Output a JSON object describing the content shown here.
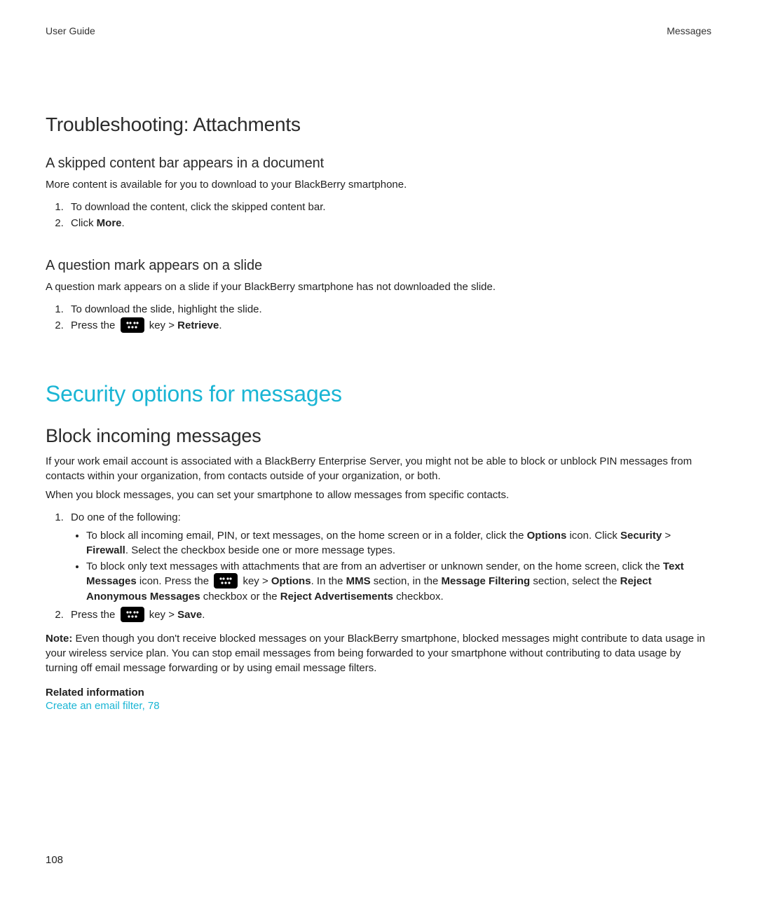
{
  "header": {
    "left": "User Guide",
    "right": "Messages"
  },
  "sections": {
    "troubleshooting": {
      "title": "Troubleshooting: Attachments",
      "skipped": {
        "heading": "A skipped content bar appears in a document",
        "intro": "More content is available for you to download to your BlackBerry smartphone.",
        "step1": "To download the content, click the skipped content bar.",
        "step2_prefix": "Click ",
        "step2_bold": "More",
        "step2_suffix": "."
      },
      "question": {
        "heading": "A question mark appears on a slide",
        "intro": "A question mark appears on a slide if your BlackBerry smartphone has not downloaded the slide.",
        "step1": "To download the slide, highlight the slide.",
        "step2_prefix": "Press the ",
        "step2_mid": " key > ",
        "step2_bold": "Retrieve",
        "step2_suffix": "."
      }
    },
    "security": {
      "title": "Security options for messages",
      "block": {
        "heading": "Block incoming messages",
        "para1": "If your work email account is associated with a BlackBerry Enterprise Server, you might not be able to block or unblock PIN messages from contacts within your organization, from contacts outside of your organization, or both.",
        "para2": "When you block messages, you can set your smartphone to allow messages from specific contacts.",
        "step1": "Do one of the following:",
        "bullet1_a": "To block all incoming email, PIN, or text messages, on the home screen or in a folder, click the ",
        "bullet1_b": "Options",
        "bullet1_c": " icon. Click ",
        "bullet1_d": "Security",
        "bullet1_e": " > ",
        "bullet1_f": "Firewall",
        "bullet1_g": ". Select the checkbox beside one or more message types.",
        "bullet2_a": "To block only text messages with attachments that are from an advertiser or unknown sender, on the home screen, click the ",
        "bullet2_b": "Text Messages",
        "bullet2_c": " icon. Press the ",
        "bullet2_d": " key > ",
        "bullet2_e": "Options",
        "bullet2_f": ". In the ",
        "bullet2_g": "MMS",
        "bullet2_h": " section, in the ",
        "bullet2_i": "Message Filtering",
        "bullet2_j": " section, select the ",
        "bullet2_k": "Reject Anonymous Messages",
        "bullet2_l": " checkbox or the ",
        "bullet2_m": "Reject Advertisements",
        "bullet2_n": " checkbox.",
        "step2_prefix": "Press the ",
        "step2_mid": " key > ",
        "step2_bold": "Save",
        "step2_suffix": ".",
        "note_label": "Note:",
        "note_body": " Even though you don't receive blocked messages on your BlackBerry smartphone, blocked messages might contribute to data usage in your wireless service plan. You can stop email messages from being forwarded to your smartphone without contributing to data usage by turning off email message forwarding or by using email message filters.",
        "related_label": "Related information",
        "related_link": "Create an email filter, 78"
      }
    }
  },
  "page_number": "108"
}
